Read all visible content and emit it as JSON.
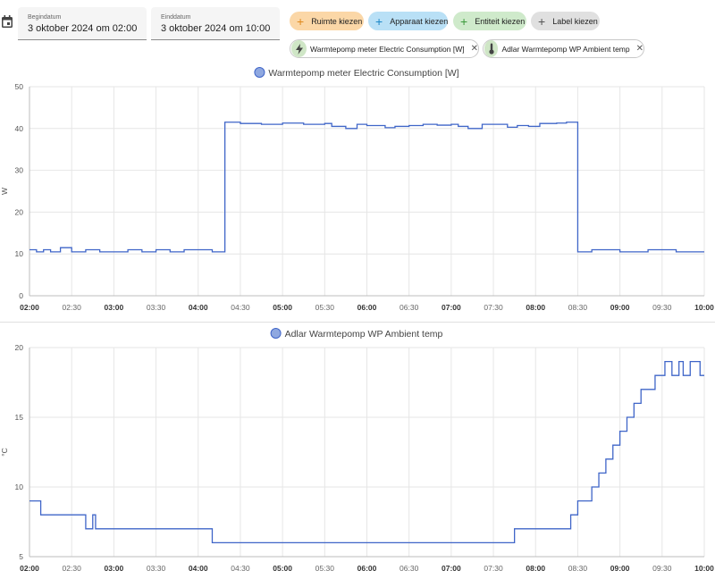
{
  "date_range": {
    "start_label": "Begindatum",
    "start_value": "3 oktober 2024 om 02:00",
    "end_label": "Einddatum",
    "end_value": "3 oktober 2024 om 10:00"
  },
  "target_chips": [
    {
      "label": "Ruimte kiezen",
      "color": "#fbd7a7"
    },
    {
      "label": "Apparaat kiezen",
      "color": "#b9e0f6"
    },
    {
      "label": "Entiteit kiezen",
      "color": "#cfeacb"
    },
    {
      "label": "Label kiezen",
      "color": "#e0e0e0"
    }
  ],
  "selected_entities": [
    {
      "label": "Warmtepomp meter Electric Consumption [W]",
      "icon": "lightning-bolt-icon"
    },
    {
      "label": "Adlar Warmtepomp WP Ambient temp",
      "icon": "thermometer-icon"
    }
  ],
  "chart_data": [
    {
      "type": "line",
      "step": true,
      "title": "Warmtepomp meter Electric Consumption [W]",
      "legend": "Warmtepomp meter Electric Consumption [W]",
      "ylabel": "W",
      "ylim": [
        0,
        50
      ],
      "yticks": [
        0,
        10,
        20,
        30,
        40,
        50
      ],
      "xlim": [
        "02:00",
        "10:00"
      ],
      "xticks": [
        "02:00",
        "02:30",
        "03:00",
        "03:30",
        "04:00",
        "04:30",
        "05:00",
        "05:30",
        "06:00",
        "06:30",
        "07:00",
        "07:30",
        "08:00",
        "08:30",
        "09:00",
        "09:30",
        "10:00"
      ],
      "color": "#3f65c8",
      "points": [
        [
          "02:00",
          11
        ],
        [
          "02:05",
          10.5
        ],
        [
          "02:10",
          11
        ],
        [
          "02:15",
          10.5
        ],
        [
          "02:22",
          11.5
        ],
        [
          "02:30",
          10.5
        ],
        [
          "02:40",
          11
        ],
        [
          "02:50",
          10.5
        ],
        [
          "03:00",
          10.5
        ],
        [
          "03:10",
          11
        ],
        [
          "03:20",
          10.5
        ],
        [
          "03:30",
          11
        ],
        [
          "03:40",
          10.5
        ],
        [
          "03:50",
          11
        ],
        [
          "04:00",
          11
        ],
        [
          "04:10",
          10.5
        ],
        [
          "04:19",
          41.5
        ],
        [
          "04:30",
          41.2
        ],
        [
          "04:45",
          41
        ],
        [
          "05:00",
          41.3
        ],
        [
          "05:15",
          41
        ],
        [
          "05:30",
          41.2
        ],
        [
          "05:35",
          40.5
        ],
        [
          "05:45",
          40
        ],
        [
          "05:53",
          41
        ],
        [
          "06:00",
          40.7
        ],
        [
          "06:13",
          40.2
        ],
        [
          "06:20",
          40.5
        ],
        [
          "06:30",
          40.7
        ],
        [
          "06:40",
          41
        ],
        [
          "06:50",
          40.8
        ],
        [
          "07:00",
          41
        ],
        [
          "07:05",
          40.5
        ],
        [
          "07:12",
          40
        ],
        [
          "07:22",
          41
        ],
        [
          "07:30",
          41
        ],
        [
          "07:40",
          40.3
        ],
        [
          "07:47",
          40.7
        ],
        [
          "07:55",
          40.5
        ],
        [
          "08:03",
          41.2
        ],
        [
          "08:15",
          41.3
        ],
        [
          "08:22",
          41.5
        ],
        [
          "08:30",
          10.5
        ],
        [
          "08:40",
          11
        ],
        [
          "09:00",
          10.5
        ],
        [
          "09:20",
          11
        ],
        [
          "09:40",
          10.5
        ],
        [
          "10:00",
          10.5
        ]
      ]
    },
    {
      "type": "line",
      "step": true,
      "title": "Adlar Warmtepomp WP Ambient temp",
      "legend": "Adlar Warmtepomp WP Ambient temp",
      "ylabel": "°C",
      "ylim": [
        5,
        20
      ],
      "yticks": [
        5,
        10,
        15,
        20
      ],
      "xlim": [
        "02:00",
        "10:00"
      ],
      "xticks": [
        "02:00",
        "02:30",
        "03:00",
        "03:30",
        "04:00",
        "04:30",
        "05:00",
        "05:30",
        "06:00",
        "06:30",
        "07:00",
        "07:30",
        "08:00",
        "08:30",
        "09:00",
        "09:30",
        "10:00"
      ],
      "color": "#3f65c8",
      "points": [
        [
          "02:00",
          9
        ],
        [
          "02:08",
          8
        ],
        [
          "02:40",
          7
        ],
        [
          "02:45",
          8
        ],
        [
          "02:47",
          7
        ],
        [
          "04:10",
          6
        ],
        [
          "05:20",
          6
        ],
        [
          "07:45",
          7
        ],
        [
          "08:25",
          8
        ],
        [
          "08:30",
          9
        ],
        [
          "08:40",
          10
        ],
        [
          "08:45",
          11
        ],
        [
          "08:50",
          12
        ],
        [
          "08:55",
          13
        ],
        [
          "09:00",
          14
        ],
        [
          "09:05",
          15
        ],
        [
          "09:10",
          16
        ],
        [
          "09:15",
          17
        ],
        [
          "09:25",
          18
        ],
        [
          "09:32",
          19
        ],
        [
          "09:37",
          18
        ],
        [
          "09:42",
          19
        ],
        [
          "09:45",
          18
        ],
        [
          "09:50",
          19
        ],
        [
          "09:57",
          18
        ],
        [
          "10:00",
          18
        ]
      ]
    }
  ]
}
